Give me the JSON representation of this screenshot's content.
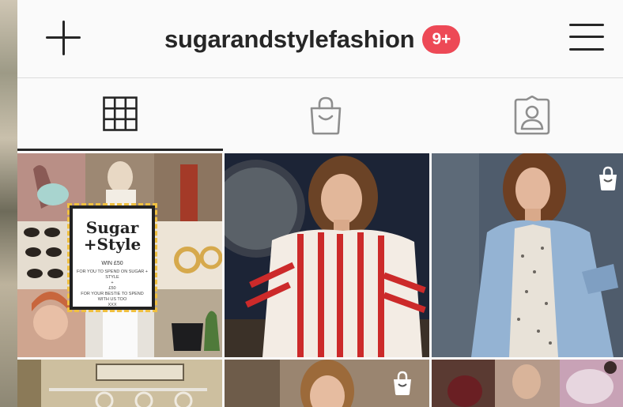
{
  "header": {
    "username": "sugarandstylefashion",
    "notification_badge": "9+",
    "new_post_icon": "plus-icon",
    "menu_icon": "hamburger-menu-icon"
  },
  "tabs": [
    {
      "name": "posts-grid",
      "icon": "grid-icon",
      "active": true
    },
    {
      "name": "shop",
      "icon": "shopping-bag-icon",
      "active": false
    },
    {
      "name": "tagged",
      "icon": "tagged-user-icon",
      "active": false
    }
  ],
  "posts": {
    "giveaway": {
      "logo_line1": "Sugar",
      "logo_line2": "+Style",
      "win_line": "WIN £50",
      "small_line1": "FOR YOU TO SPEND ON SUGAR + STYLE",
      "small_line2": "+",
      "small_line3": "£50",
      "small_line4": "FOR YOUR BESTIE TO SPEND WITH US TOO",
      "small_line5": "XXX"
    },
    "shop_badge_icon": "shopping-bag-icon"
  },
  "colors": {
    "badge_red": "#ed4956",
    "text_dark": "#262626",
    "background": "#fafafa"
  }
}
